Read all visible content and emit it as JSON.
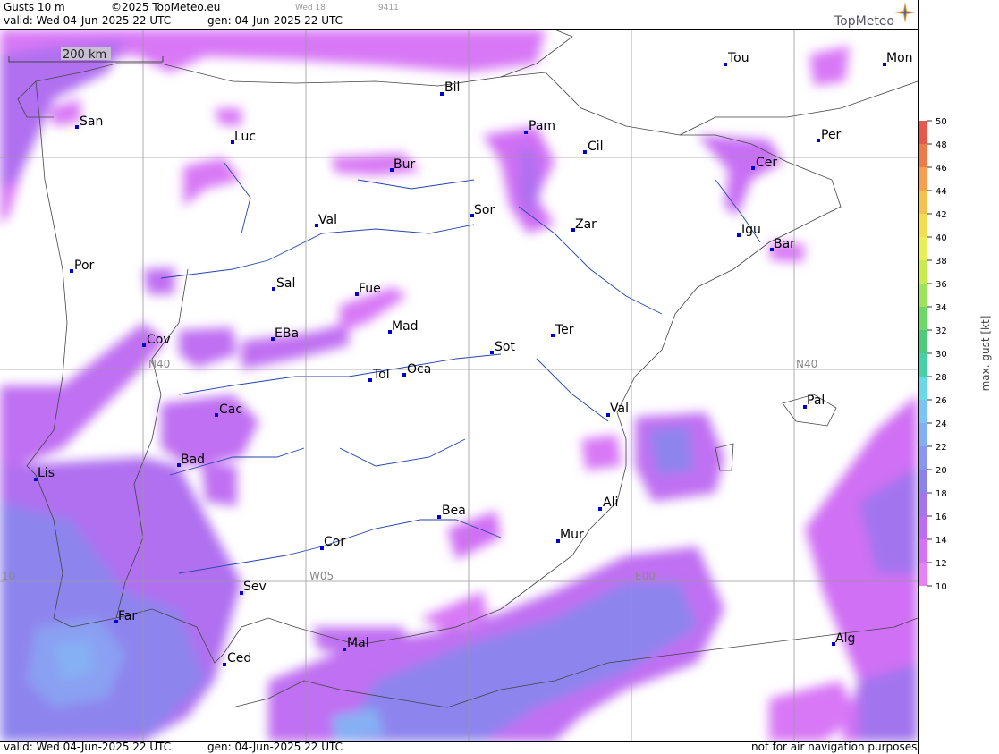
{
  "header": {
    "title": "Gusts 10 m",
    "copyright": "©2025 TopMeteo.eu",
    "run_day": "Wed 18",
    "code": "9411",
    "valid": "valid:  Wed  04-Jun-2025  22 UTC",
    "gen": "gen: 04-Jun-2025  22 UTC",
    "logo": "TopMeteo"
  },
  "footer": {
    "valid": "valid:  Wed  04-Jun-2025  22 UTC",
    "gen": "gen: 04-Jun-2025  22 UTC",
    "note": "not for air navigation purposes"
  },
  "map": {
    "scale_label": "200 km",
    "grid_labels": {
      "lat40": "N40",
      "lon_w05": "W05",
      "lon_e00": "E00",
      "lon_w10": "10"
    },
    "cities": [
      "San",
      "Bil",
      "Tou",
      "Mon",
      "Luc",
      "Pam",
      "Cil",
      "Per",
      "Bur",
      "Cer",
      "Val",
      "Sor",
      "Zar",
      "Igu",
      "Bar",
      "Por",
      "Sal",
      "Fue",
      "Mad",
      "EBa",
      "Cov",
      "Ter",
      "Sot",
      "Tol",
      "Oca",
      "Pal",
      "Cac",
      "Val",
      "Bad",
      "Lis",
      "Bea",
      "Ali",
      "Cor",
      "Mur",
      "Sev",
      "Far",
      "Mal",
      "Alg",
      "Ced"
    ]
  },
  "legend": {
    "title": "max. gust  [kt]",
    "ticks": [
      "50",
      "48",
      "46",
      "44",
      "42",
      "40",
      "38",
      "36",
      "34",
      "32",
      "30",
      "28",
      "26",
      "24",
      "22",
      "20",
      "18",
      "16",
      "14",
      "12",
      "10"
    ],
    "colors": [
      "#e8584a",
      "#ee7a48",
      "#f4a04c",
      "#f5c24e",
      "#f2de4e",
      "#e8ee55",
      "#c8ec50",
      "#9de45a",
      "#6cd866",
      "#4ccc7a",
      "#46d0a8",
      "#6ad8e8",
      "#7cc4f4",
      "#82aef4",
      "#8896f0",
      "#8c82ec",
      "#a274ee",
      "#be6cf2",
      "#d670f4",
      "#e880f6"
    ]
  }
}
